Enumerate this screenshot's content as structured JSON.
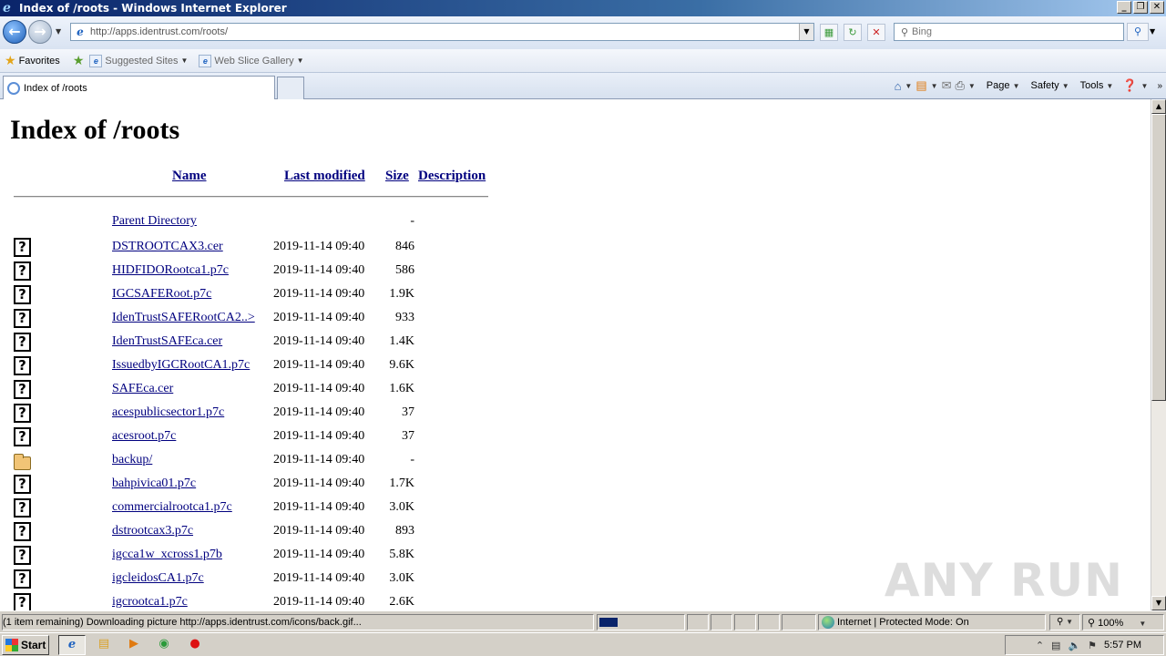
{
  "window": {
    "title": "Index of /roots - Windows Internet Explorer",
    "buttons": [
      "_",
      "❐",
      "✕"
    ]
  },
  "nav": {
    "url": "http://apps.identrust.com/roots/",
    "search_placeholder": "Bing"
  },
  "favorites_bar": {
    "favorites_label": "Favorites",
    "items": [
      {
        "label": "Suggested Sites"
      },
      {
        "label": "Web Slice Gallery"
      }
    ]
  },
  "tabs": [
    {
      "label": "Index of /roots"
    }
  ],
  "command_bar": {
    "page": "Page",
    "safety": "Safety",
    "tools": "Tools"
  },
  "page": {
    "heading": "Index of /roots",
    "columns": {
      "name": "Name",
      "last_modified": "Last modified",
      "size": "Size",
      "description": "Description"
    },
    "parent": {
      "name": "Parent Directory",
      "size": "-"
    },
    "files": [
      {
        "icon": "unknown",
        "name": "DSTROOTCAX3.cer",
        "date": "2019-11-14 09:40",
        "size": "846"
      },
      {
        "icon": "unknown",
        "name": "HIDFIDORootca1.p7c",
        "date": "2019-11-14 09:40",
        "size": "586"
      },
      {
        "icon": "unknown",
        "name": "IGCSAFERoot.p7c",
        "date": "2019-11-14 09:40",
        "size": "1.9K"
      },
      {
        "icon": "unknown",
        "name": "IdenTrustSAFERootCA2..>",
        "date": "2019-11-14 09:40",
        "size": "933"
      },
      {
        "icon": "unknown",
        "name": "IdenTrustSAFEca.cer",
        "date": "2019-11-14 09:40",
        "size": "1.4K"
      },
      {
        "icon": "unknown",
        "name": "IssuedbyIGCRootCA1.p7c",
        "date": "2019-11-14 09:40",
        "size": "9.6K"
      },
      {
        "icon": "unknown",
        "name": "SAFEca.cer",
        "date": "2019-11-14 09:40",
        "size": "1.6K"
      },
      {
        "icon": "unknown",
        "name": "acespublicsector1.p7c",
        "date": "2019-11-14 09:40",
        "size": "37"
      },
      {
        "icon": "unknown",
        "name": "acesroot.p7c",
        "date": "2019-11-14 09:40",
        "size": "37"
      },
      {
        "icon": "folder",
        "name": "backup/",
        "date": "2019-11-14 09:40",
        "size": "-"
      },
      {
        "icon": "unknown",
        "name": "bahpivica01.p7c",
        "date": "2019-11-14 09:40",
        "size": "1.7K"
      },
      {
        "icon": "unknown",
        "name": "commercialrootca1.p7c",
        "date": "2019-11-14 09:40",
        "size": "3.0K"
      },
      {
        "icon": "unknown",
        "name": "dstrootcax3.p7c",
        "date": "2019-11-14 09:40",
        "size": "893"
      },
      {
        "icon": "unknown",
        "name": "igcca1w_xcross1.p7b",
        "date": "2019-11-14 09:40",
        "size": "5.8K"
      },
      {
        "icon": "unknown",
        "name": "igcleidosCA1.p7c",
        "date": "2019-11-14 09:40",
        "size": "3.0K"
      },
      {
        "icon": "unknown",
        "name": "igcrootca1.p7c",
        "date": "2019-11-14 09:40",
        "size": "2.6K"
      }
    ],
    "watermark": "ANY RUN"
  },
  "status_bar": {
    "text": "(1 item remaining) Downloading picture http://apps.identrust.com/icons/back.gif...",
    "progress": 0.22,
    "zone": "Internet | Protected Mode: On",
    "zoom": "100%"
  },
  "taskbar": {
    "start_label": "Start",
    "clock": "5:57 PM"
  }
}
